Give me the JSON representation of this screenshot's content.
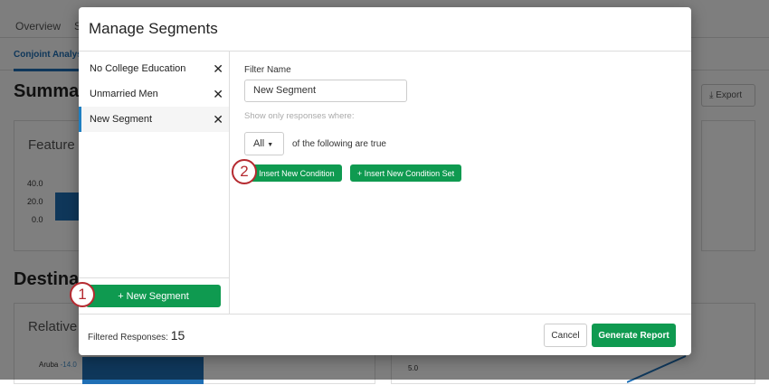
{
  "background": {
    "nav_tabs": [
      "Overview",
      "S"
    ],
    "sub_tab": "Conjoint Analysis",
    "summary_heading": "Summary",
    "export_label": "Export",
    "feature_card_title": "Feature In",
    "axis_ticks": [
      "40.0",
      "20.0",
      "0.0"
    ],
    "destination_heading": "Destinati",
    "relative_card_title": "Relative U",
    "aruba_label": "Aruba",
    "aruba_value": "-14.0",
    "right_tick": "5.0"
  },
  "modal": {
    "title": "Manage Segments",
    "segments": [
      {
        "label": "No College Education"
      },
      {
        "label": "Unmarried Men"
      },
      {
        "label": "New Segment",
        "selected": true
      }
    ],
    "new_segment_label": "+ New Segment",
    "filter_name_label": "Filter Name",
    "filter_name_value": "New Segment",
    "hint": "Show only responses where:",
    "match_select": "All",
    "match_suffix": "of the following are true",
    "insert_condition": "+  Insert New Condition",
    "insert_condition_set": "+  Insert New Condition Set",
    "filtered_label": "Filtered Responses:",
    "filtered_count": "15",
    "cancel": "Cancel",
    "generate": "Generate Report"
  },
  "markers": [
    "1",
    "2"
  ],
  "colors": {
    "green": "#0f9a50",
    "blue": "#1f6fb5",
    "marker": "#b52a30"
  }
}
